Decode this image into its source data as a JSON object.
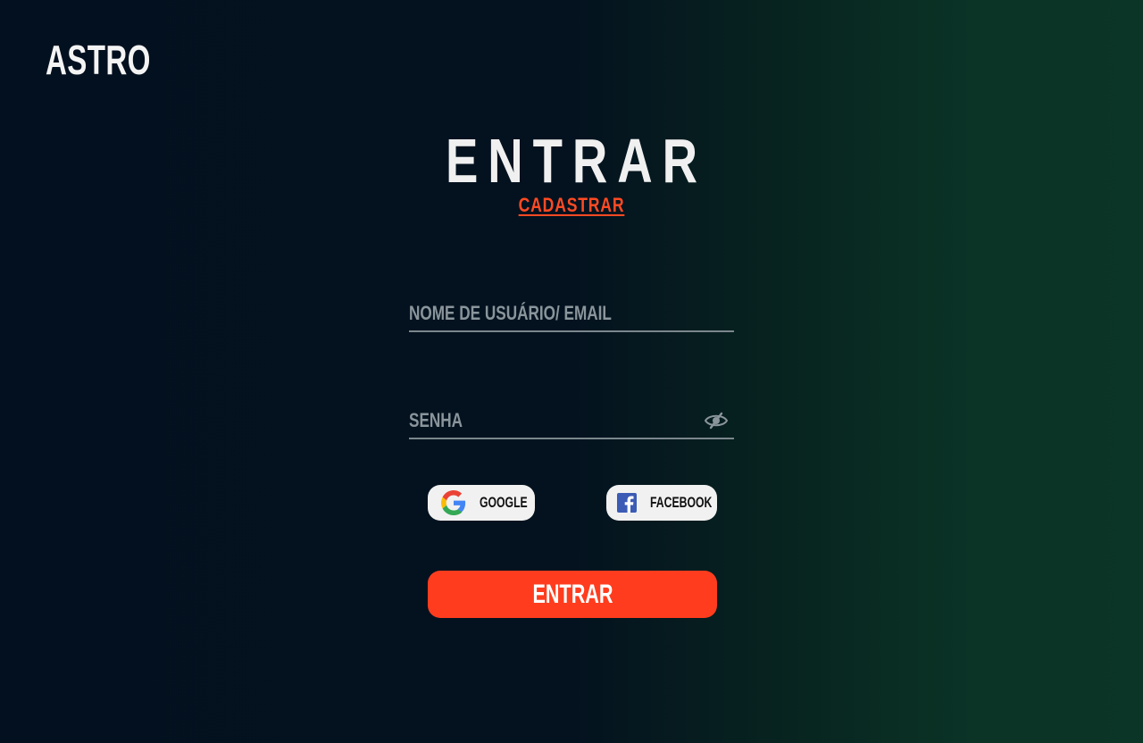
{
  "brand": {
    "logo_text": "ASTRO"
  },
  "login": {
    "title": "ENTRAR",
    "signup_link": "CADASTRAR",
    "username_field": {
      "placeholder": "NOME DE USUÁRIO/ EMAIL",
      "value": ""
    },
    "password_field": {
      "placeholder": "SENHA",
      "value": "",
      "toggle_icon": "eye-slash-icon"
    },
    "social": {
      "google_label": "GOOGLE",
      "google_icon": "google-icon",
      "facebook_label": "FACEBOOK",
      "facebook_icon": "facebook-icon"
    },
    "submit_label": "ENTRAR"
  },
  "colors": {
    "accent": "#ff3d1e",
    "link": "#ff4a23",
    "background_start": "#03101f",
    "background_end": "#0b3526",
    "button_light": "#f1f1f1"
  }
}
